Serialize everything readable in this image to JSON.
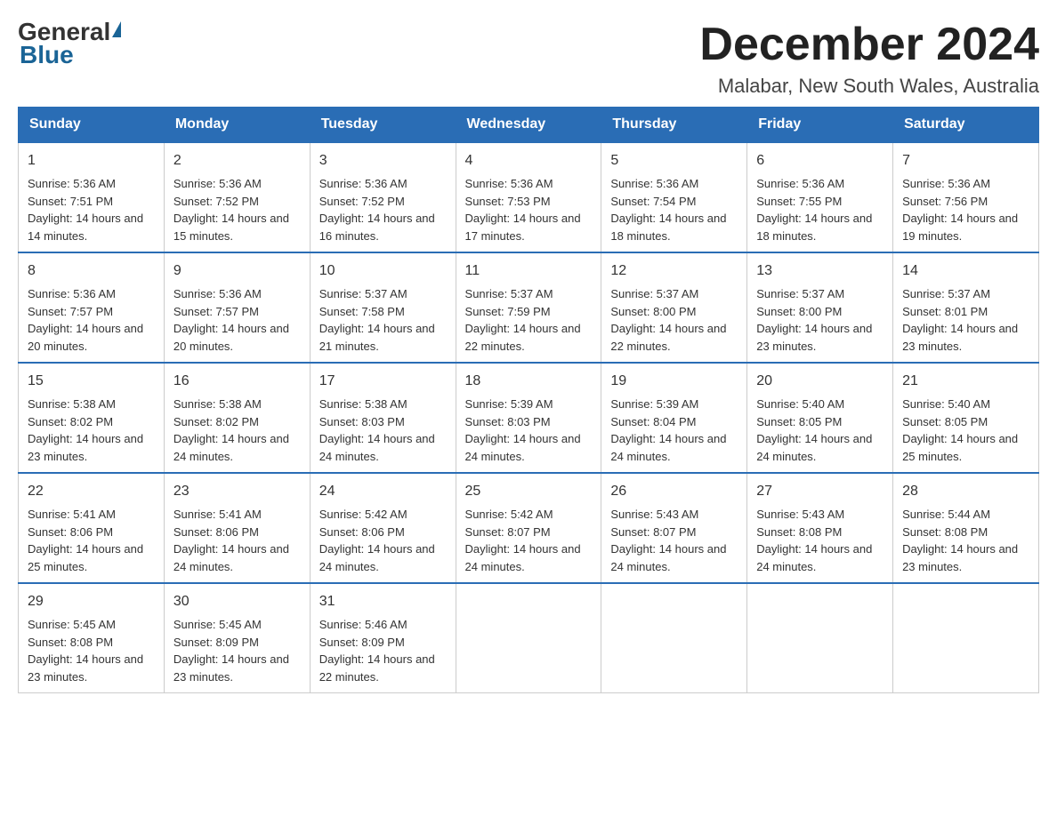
{
  "header": {
    "logo_general": "General",
    "logo_blue": "Blue",
    "month_title": "December 2024",
    "subtitle": "Malabar, New South Wales, Australia"
  },
  "days_of_week": [
    "Sunday",
    "Monday",
    "Tuesday",
    "Wednesday",
    "Thursday",
    "Friday",
    "Saturday"
  ],
  "weeks": [
    [
      {
        "day": "1",
        "sunrise": "Sunrise: 5:36 AM",
        "sunset": "Sunset: 7:51 PM",
        "daylight": "Daylight: 14 hours and 14 minutes."
      },
      {
        "day": "2",
        "sunrise": "Sunrise: 5:36 AM",
        "sunset": "Sunset: 7:52 PM",
        "daylight": "Daylight: 14 hours and 15 minutes."
      },
      {
        "day": "3",
        "sunrise": "Sunrise: 5:36 AM",
        "sunset": "Sunset: 7:52 PM",
        "daylight": "Daylight: 14 hours and 16 minutes."
      },
      {
        "day": "4",
        "sunrise": "Sunrise: 5:36 AM",
        "sunset": "Sunset: 7:53 PM",
        "daylight": "Daylight: 14 hours and 17 minutes."
      },
      {
        "day": "5",
        "sunrise": "Sunrise: 5:36 AM",
        "sunset": "Sunset: 7:54 PM",
        "daylight": "Daylight: 14 hours and 18 minutes."
      },
      {
        "day": "6",
        "sunrise": "Sunrise: 5:36 AM",
        "sunset": "Sunset: 7:55 PM",
        "daylight": "Daylight: 14 hours and 18 minutes."
      },
      {
        "day": "7",
        "sunrise": "Sunrise: 5:36 AM",
        "sunset": "Sunset: 7:56 PM",
        "daylight": "Daylight: 14 hours and 19 minutes."
      }
    ],
    [
      {
        "day": "8",
        "sunrise": "Sunrise: 5:36 AM",
        "sunset": "Sunset: 7:57 PM",
        "daylight": "Daylight: 14 hours and 20 minutes."
      },
      {
        "day": "9",
        "sunrise": "Sunrise: 5:36 AM",
        "sunset": "Sunset: 7:57 PM",
        "daylight": "Daylight: 14 hours and 20 minutes."
      },
      {
        "day": "10",
        "sunrise": "Sunrise: 5:37 AM",
        "sunset": "Sunset: 7:58 PM",
        "daylight": "Daylight: 14 hours and 21 minutes."
      },
      {
        "day": "11",
        "sunrise": "Sunrise: 5:37 AM",
        "sunset": "Sunset: 7:59 PM",
        "daylight": "Daylight: 14 hours and 22 minutes."
      },
      {
        "day": "12",
        "sunrise": "Sunrise: 5:37 AM",
        "sunset": "Sunset: 8:00 PM",
        "daylight": "Daylight: 14 hours and 22 minutes."
      },
      {
        "day": "13",
        "sunrise": "Sunrise: 5:37 AM",
        "sunset": "Sunset: 8:00 PM",
        "daylight": "Daylight: 14 hours and 23 minutes."
      },
      {
        "day": "14",
        "sunrise": "Sunrise: 5:37 AM",
        "sunset": "Sunset: 8:01 PM",
        "daylight": "Daylight: 14 hours and 23 minutes."
      }
    ],
    [
      {
        "day": "15",
        "sunrise": "Sunrise: 5:38 AM",
        "sunset": "Sunset: 8:02 PM",
        "daylight": "Daylight: 14 hours and 23 minutes."
      },
      {
        "day": "16",
        "sunrise": "Sunrise: 5:38 AM",
        "sunset": "Sunset: 8:02 PM",
        "daylight": "Daylight: 14 hours and 24 minutes."
      },
      {
        "day": "17",
        "sunrise": "Sunrise: 5:38 AM",
        "sunset": "Sunset: 8:03 PM",
        "daylight": "Daylight: 14 hours and 24 minutes."
      },
      {
        "day": "18",
        "sunrise": "Sunrise: 5:39 AM",
        "sunset": "Sunset: 8:03 PM",
        "daylight": "Daylight: 14 hours and 24 minutes."
      },
      {
        "day": "19",
        "sunrise": "Sunrise: 5:39 AM",
        "sunset": "Sunset: 8:04 PM",
        "daylight": "Daylight: 14 hours and 24 minutes."
      },
      {
        "day": "20",
        "sunrise": "Sunrise: 5:40 AM",
        "sunset": "Sunset: 8:05 PM",
        "daylight": "Daylight: 14 hours and 24 minutes."
      },
      {
        "day": "21",
        "sunrise": "Sunrise: 5:40 AM",
        "sunset": "Sunset: 8:05 PM",
        "daylight": "Daylight: 14 hours and 25 minutes."
      }
    ],
    [
      {
        "day": "22",
        "sunrise": "Sunrise: 5:41 AM",
        "sunset": "Sunset: 8:06 PM",
        "daylight": "Daylight: 14 hours and 25 minutes."
      },
      {
        "day": "23",
        "sunrise": "Sunrise: 5:41 AM",
        "sunset": "Sunset: 8:06 PM",
        "daylight": "Daylight: 14 hours and 24 minutes."
      },
      {
        "day": "24",
        "sunrise": "Sunrise: 5:42 AM",
        "sunset": "Sunset: 8:06 PM",
        "daylight": "Daylight: 14 hours and 24 minutes."
      },
      {
        "day": "25",
        "sunrise": "Sunrise: 5:42 AM",
        "sunset": "Sunset: 8:07 PM",
        "daylight": "Daylight: 14 hours and 24 minutes."
      },
      {
        "day": "26",
        "sunrise": "Sunrise: 5:43 AM",
        "sunset": "Sunset: 8:07 PM",
        "daylight": "Daylight: 14 hours and 24 minutes."
      },
      {
        "day": "27",
        "sunrise": "Sunrise: 5:43 AM",
        "sunset": "Sunset: 8:08 PM",
        "daylight": "Daylight: 14 hours and 24 minutes."
      },
      {
        "day": "28",
        "sunrise": "Sunrise: 5:44 AM",
        "sunset": "Sunset: 8:08 PM",
        "daylight": "Daylight: 14 hours and 23 minutes."
      }
    ],
    [
      {
        "day": "29",
        "sunrise": "Sunrise: 5:45 AM",
        "sunset": "Sunset: 8:08 PM",
        "daylight": "Daylight: 14 hours and 23 minutes."
      },
      {
        "day": "30",
        "sunrise": "Sunrise: 5:45 AM",
        "sunset": "Sunset: 8:09 PM",
        "daylight": "Daylight: 14 hours and 23 minutes."
      },
      {
        "day": "31",
        "sunrise": "Sunrise: 5:46 AM",
        "sunset": "Sunset: 8:09 PM",
        "daylight": "Daylight: 14 hours and 22 minutes."
      },
      null,
      null,
      null,
      null
    ]
  ]
}
